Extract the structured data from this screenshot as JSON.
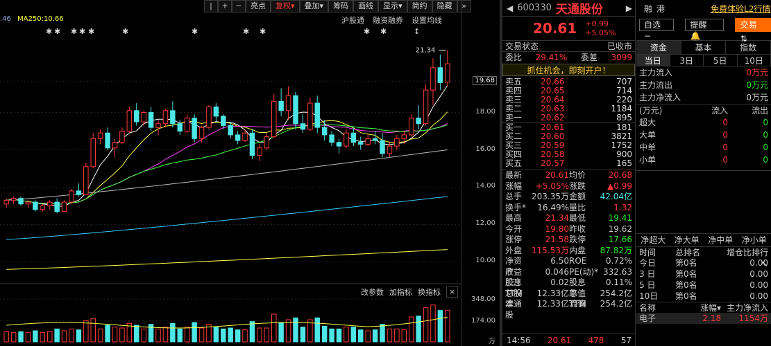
{
  "toolbar": {
    "buttons": [
      "|",
      "+",
      "−",
      "亮点",
      "复权",
      "叠加",
      "筹码",
      "画线",
      "显示",
      "简约",
      "隐藏"
    ],
    "fuquan_arrow": "▾",
    "more_icon": "»"
  },
  "legend": {
    "ma_prefix": ".46",
    "ma250": "MA250:10.66"
  },
  "subnav": [
    "沪股通",
    "融资融券",
    "设置均线"
  ],
  "price_ticks": [
    {
      "label": "19.68",
      "value": 19.68,
      "boxed": true
    },
    {
      "label": "18.00",
      "value": 18.0
    },
    {
      "label": "16.00",
      "value": 16.0
    },
    {
      "label": "14.00",
      "value": 14.0
    },
    {
      "label": "12.00",
      "value": 12.0
    },
    {
      "label": "10.00",
      "value": 10.0
    }
  ],
  "high_marker": "21.34",
  "vol_ticks": [
    "348.00",
    "174.00",
    "万"
  ],
  "indicator_bar": [
    "改参数",
    "加指标",
    "换指标"
  ],
  "quote": {
    "code": "600330",
    "name": "天通股份",
    "price": "20.61",
    "change": "+0.99",
    "change_pct": "+5.05%",
    "tag_rong": "融",
    "tag_gang": "港",
    "l2_link": "免费体验L2行情",
    "status_label": "交易状态",
    "status_value": "已收市",
    "weibi_label": "委比",
    "weibi_value": "29.41%",
    "weicha_label": "委差",
    "weicha_value": "3099",
    "banner": "抓住机会，即刻开户！",
    "asks": [
      {
        "label": "卖五",
        "price": "20.66",
        "vol": "707"
      },
      {
        "label": "卖四",
        "price": "20.65",
        "vol": "714"
      },
      {
        "label": "卖三",
        "price": "20.64",
        "vol": "220"
      },
      {
        "label": "卖二",
        "price": "20.63",
        "vol": "1184"
      },
      {
        "label": "卖一",
        "price": "20.62",
        "vol": "895"
      }
    ],
    "bids": [
      {
        "label": "买一",
        "price": "20.61",
        "vol": "181"
      },
      {
        "label": "买二",
        "price": "20.60",
        "vol": "3821"
      },
      {
        "label": "买三",
        "price": "20.59",
        "vol": "1752"
      },
      {
        "label": "买四",
        "price": "20.58",
        "vol": "900"
      },
      {
        "label": "买五",
        "price": "20.57",
        "vol": "165"
      }
    ],
    "stats": [
      [
        "最新",
        "20.61",
        "均价",
        "20.68",
        "red",
        "red"
      ],
      [
        "涨幅",
        "+5.05%",
        "涨跌",
        "▲0.99",
        "red",
        "red"
      ],
      [
        "总手",
        "203.35万",
        "金额",
        "42.04亿",
        "",
        "cyan"
      ],
      [
        "换手*",
        "16.49%",
        "量比",
        "1.32",
        "",
        "red"
      ],
      [
        "最高",
        "21.34",
        "最低",
        "19.41",
        "red",
        "green"
      ],
      [
        "今开",
        "19.80",
        "昨收",
        "19.62",
        "red",
        ""
      ],
      [
        "涨停",
        "21.58",
        "跌停",
        "17.66",
        "red",
        "green"
      ],
      [
        "外盘",
        "115.53万",
        "内盘",
        "87.82万",
        "red",
        "green"
      ],
      [
        "净资产",
        "6.50",
        "ROE",
        "0.72%",
        "",
        ""
      ],
      [
        "收益(三)",
        "0.046",
        "PE(动)*",
        "332.63",
        "",
        ""
      ],
      [
        "股息TTM",
        "0.02",
        "股息率TTM",
        "0.11%",
        "",
        ""
      ],
      [
        "总股本",
        "12.33亿",
        "总值",
        "254.2亿",
        "",
        ""
      ],
      [
        "流通股",
        "12.33亿",
        "流值",
        "254.2亿",
        "",
        ""
      ]
    ],
    "time": "14:56",
    "last_price": "20.61",
    "last_vol": "478",
    "last_count": "57"
  },
  "fund": {
    "select_label": "自选",
    "alert_label": "提醒",
    "trade_label": "交易",
    "tabs": [
      "资金",
      "基本",
      "指数"
    ],
    "period_tabs": [
      "当日",
      "3日",
      "5日",
      "10日"
    ],
    "flows": [
      [
        "主力流入",
        "0万元",
        "red"
      ],
      [
        "主力流出",
        "0万元",
        "green"
      ],
      [
        "主力净流入",
        "0万元",
        ""
      ]
    ],
    "unit": "(万元)",
    "col_in": "流入",
    "col_out": "流出",
    "size_rows": [
      [
        "超大",
        "0",
        "0"
      ],
      [
        "大单",
        "0",
        "0"
      ],
      [
        "中单",
        "0",
        "0"
      ],
      [
        "小单",
        "0",
        "0"
      ]
    ],
    "net_tabs": [
      "净超大",
      "净大单",
      "净中单",
      "净小单"
    ],
    "rank_head": [
      "时间",
      "总排名",
      "增仓比排行"
    ],
    "rank_rows": [
      [
        "今日",
        "第0名",
        "0.00"
      ],
      [
        "3 日",
        "第0名",
        "0.00"
      ],
      [
        "5 日",
        "第0名",
        "0.00"
      ],
      [
        "10日",
        "第0名",
        "0.00"
      ]
    ],
    "bottom_head": [
      "名称",
      "涨幅",
      "主力净流入"
    ],
    "bottom_row": [
      "电子",
      "2.18",
      "1154万"
    ]
  },
  "colors": {
    "up": "#ff3a3a",
    "down": "#4ce6e6",
    "ma5": "#ffffff",
    "ma10": "#ffff44",
    "ma20": "#ff44ff",
    "ma30": "#44ff44",
    "ma60": "#bbbbbb",
    "ma120": "#33ccff",
    "ma250": "#ffff44"
  },
  "chart_data": {
    "type": "candlestick",
    "note_ticks_y": [
      10,
      12,
      14,
      16,
      18,
      19.68
    ],
    "candles": [
      [
        13.1,
        13.4,
        12.9,
        13.3
      ],
      [
        13.3,
        13.5,
        13.1,
        13.4
      ],
      [
        13.4,
        13.5,
        13.0,
        13.1
      ],
      [
        13.1,
        13.3,
        12.9,
        13.2
      ],
      [
        13.2,
        13.3,
        12.7,
        12.8
      ],
      [
        12.8,
        13.1,
        12.7,
        13.0
      ],
      [
        13.0,
        13.3,
        12.8,
        13.2
      ],
      [
        13.2,
        13.4,
        12.6,
        12.7
      ],
      [
        12.7,
        13.3,
        12.7,
        13.2
      ],
      [
        13.2,
        13.9,
        13.1,
        13.8
      ],
      [
        13.8,
        14.2,
        13.5,
        13.6
      ],
      [
        13.6,
        15.3,
        13.6,
        15.1
      ],
      [
        15.1,
        16.9,
        15.0,
        16.6
      ],
      [
        16.6,
        17.1,
        16.3,
        16.9
      ],
      [
        16.9,
        17.2,
        16.0,
        16.1
      ],
      [
        16.1,
        16.6,
        15.6,
        16.4
      ],
      [
        16.4,
        17.2,
        16.3,
        17.0
      ],
      [
        17.0,
        18.3,
        16.9,
        18.1
      ],
      [
        18.1,
        18.5,
        17.3,
        17.5
      ],
      [
        17.5,
        18.1,
        17.3,
        18.0
      ],
      [
        18.0,
        18.3,
        17.0,
        17.2
      ],
      [
        17.2,
        17.6,
        16.8,
        17.4
      ],
      [
        17.4,
        18.2,
        17.2,
        18.1
      ],
      [
        18.1,
        18.6,
        17.2,
        17.4
      ],
      [
        17.4,
        17.6,
        16.8,
        17.0
      ],
      [
        17.0,
        17.9,
        16.9,
        17.7
      ],
      [
        17.7,
        17.9,
        16.4,
        16.6
      ],
      [
        16.6,
        17.3,
        16.4,
        17.2
      ],
      [
        17.2,
        18.4,
        17.1,
        18.3
      ],
      [
        18.3,
        18.5,
        17.5,
        17.8
      ],
      [
        17.8,
        17.9,
        17.1,
        17.3
      ],
      [
        17.3,
        17.5,
        16.6,
        16.8
      ],
      [
        16.8,
        17.0,
        16.3,
        16.5
      ],
      [
        16.5,
        17.1,
        16.4,
        16.9
      ],
      [
        16.9,
        17.1,
        15.5,
        15.7
      ],
      [
        15.7,
        16.3,
        15.4,
        16.1
      ],
      [
        16.1,
        16.9,
        16.0,
        16.7
      ],
      [
        16.7,
        19.0,
        16.6,
        18.6
      ],
      [
        18.6,
        19.3,
        17.8,
        18.1
      ],
      [
        18.1,
        19.4,
        17.6,
        18.9
      ],
      [
        18.9,
        19.1,
        17.1,
        17.4
      ],
      [
        17.4,
        17.9,
        16.9,
        17.1
      ],
      [
        17.1,
        18.8,
        17.0,
        18.5
      ],
      [
        18.5,
        18.9,
        16.9,
        17.2
      ],
      [
        17.2,
        17.6,
        16.5,
        16.8
      ],
      [
        16.8,
        17.0,
        16.2,
        16.4
      ],
      [
        16.4,
        16.6,
        15.8,
        16.2
      ],
      [
        16.2,
        17.1,
        16.1,
        16.9
      ],
      [
        16.9,
        17.2,
        16.2,
        16.4
      ],
      [
        16.4,
        16.7,
        16.0,
        16.3
      ],
      [
        16.3,
        16.8,
        16.2,
        16.6
      ],
      [
        16.6,
        17.0,
        16.3,
        16.5
      ],
      [
        16.5,
        16.9,
        15.6,
        15.8
      ],
      [
        15.8,
        16.4,
        15.6,
        16.2
      ],
      [
        16.2,
        16.8,
        16.0,
        16.6
      ],
      [
        16.6,
        17.0,
        16.3,
        16.8
      ],
      [
        16.8,
        17.9,
        16.7,
        17.7
      ],
      [
        17.7,
        18.4,
        17.1,
        17.4
      ],
      [
        17.4,
        19.5,
        17.3,
        19.2
      ],
      [
        19.2,
        20.9,
        18.4,
        20.4
      ],
      [
        20.4,
        21.1,
        19.2,
        19.6
      ],
      [
        19.62,
        21.34,
        19.41,
        20.61
      ]
    ]
  }
}
